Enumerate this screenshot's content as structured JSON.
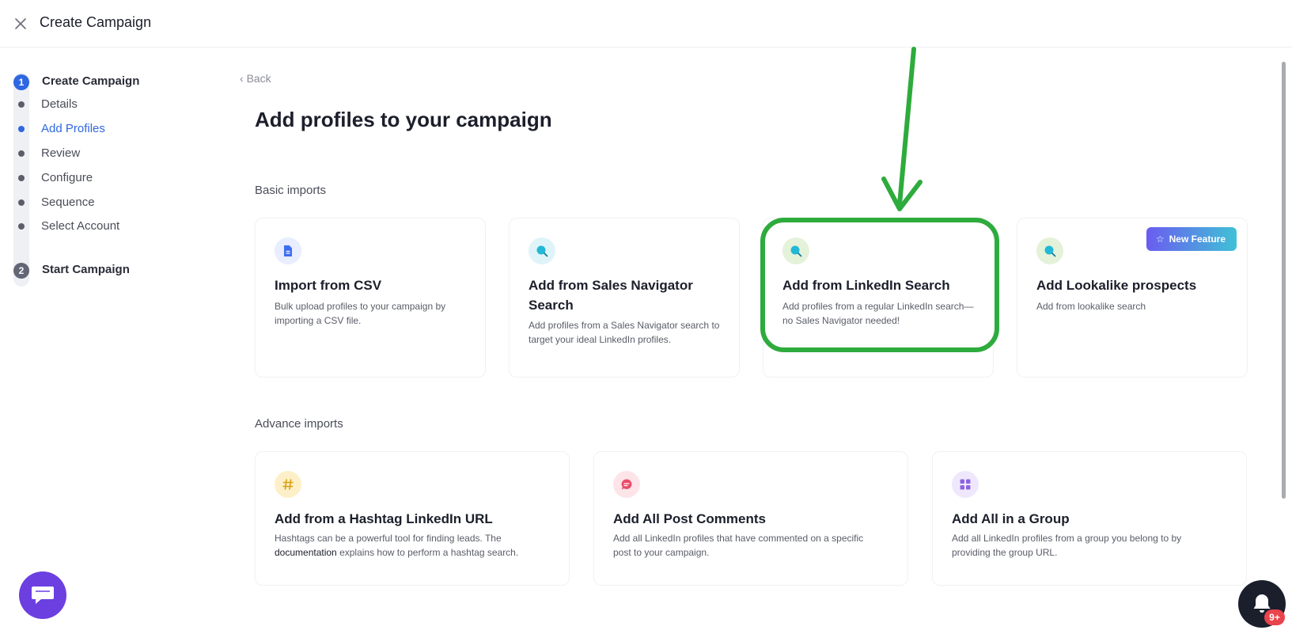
{
  "header": {
    "title": "Create Campaign"
  },
  "stepper": {
    "step1": {
      "number": "1",
      "title": "Create Campaign"
    },
    "items": [
      {
        "label": "Details"
      },
      {
        "label": "Add Profiles",
        "active": true
      },
      {
        "label": "Review"
      },
      {
        "label": "Configure"
      },
      {
        "label": "Sequence"
      },
      {
        "label": "Select Account"
      }
    ],
    "step2": {
      "number": "2",
      "title": "Start Campaign"
    }
  },
  "main": {
    "back_label": "Back",
    "title": "Add profiles to your campaign",
    "basic": {
      "label": "Basic imports",
      "cards": [
        {
          "icon": "document-icon",
          "title": "Import from CSV",
          "desc": "Bulk upload profiles to your campaign by importing a CSV file."
        },
        {
          "icon": "search-icon",
          "title": "Add from Sales Navigator Search",
          "desc": "Add profiles from a Sales Navigator search to target your ideal LinkedIn profiles."
        },
        {
          "icon": "search-icon",
          "title": "Add from LinkedIn Search",
          "desc": "Add profiles from a regular LinkedIn search—no Sales Navigator needed!"
        },
        {
          "icon": "search-icon",
          "title": "Add Lookalike prospects",
          "desc": "Add from lookalike search",
          "badge": "New Feature"
        }
      ]
    },
    "advance": {
      "label": "Advance imports",
      "cards": [
        {
          "icon": "hashtag-icon",
          "title": "Add from a Hashtag LinkedIn URL",
          "desc_before": "Hashtags can be a powerful tool for finding leads. The ",
          "desc_link": "documentation",
          "desc_after": " explains how to perform a hashtag search."
        },
        {
          "icon": "comment-icon",
          "title": "Add All Post Comments",
          "desc": "Add all LinkedIn profiles that have commented on a specific post to your campaign."
        },
        {
          "icon": "grid-icon",
          "title": "Add All in a Group",
          "desc": "Add all LinkedIn profiles from a group you belong to by providing the group URL."
        }
      ]
    }
  },
  "notifications": {
    "count": "9+"
  },
  "colors": {
    "accent": "#2f67e0",
    "annotation": "#2eab3d",
    "chat": "#6c3fe0",
    "badge": "#e9434c"
  }
}
